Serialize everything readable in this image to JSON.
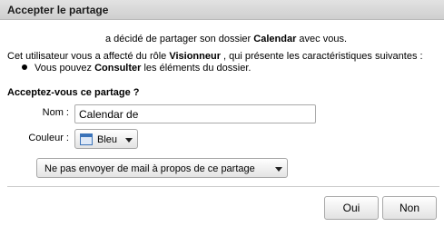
{
  "dialog": {
    "title": "Accepter le partage",
    "line1": {
      "pre": "a décidé de partager son dossier ",
      "folder": "Calendar",
      "post": " avec vous."
    },
    "line2": {
      "pre": "Cet utilisateur vous a affecté du rôle ",
      "role": "Visionneur",
      "post": " , qui présente les caractéristiques suivantes :"
    },
    "bullet": {
      "pre": "Vous pouvez ",
      "action": "Consulter",
      "post": " les éléments du dossier."
    },
    "question": "Acceptez-vous ce partage ?",
    "name_label": "Nom :",
    "name_value": "Calendar de",
    "color_label": "Couleur :",
    "color_value": "Bleu",
    "color_accent": "#3b73b9",
    "mail_option": "Ne pas envoyer de mail à propos de ce partage",
    "buttons": {
      "yes": "Oui",
      "no": "Non"
    }
  }
}
